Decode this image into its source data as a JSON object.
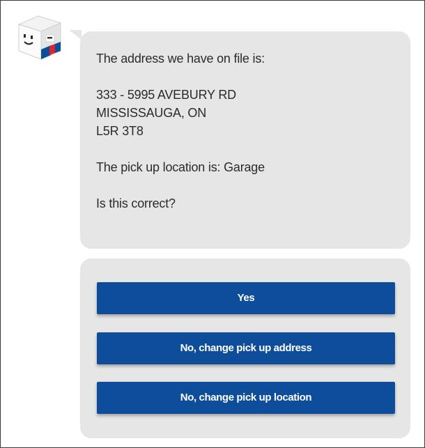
{
  "bot": {
    "avatar_icon": "box-mascot-icon"
  },
  "message": {
    "intro": "The address we have on file is:",
    "address_line1": "333 - 5995 AVEBURY RD",
    "address_line2": "MISSISSAUGA, ON",
    "address_line3": "L5R 3T8",
    "pickup_location": "The pick up location is: Garage",
    "question": "Is this correct?"
  },
  "options": {
    "yes_label": "Yes",
    "change_address_label": "No, change pick up address",
    "change_location_label": "No, change pick up location"
  },
  "colors": {
    "button_bg": "#0e4d99",
    "bubble_bg": "#e6e6e6",
    "accent_red": "#d9262c"
  }
}
